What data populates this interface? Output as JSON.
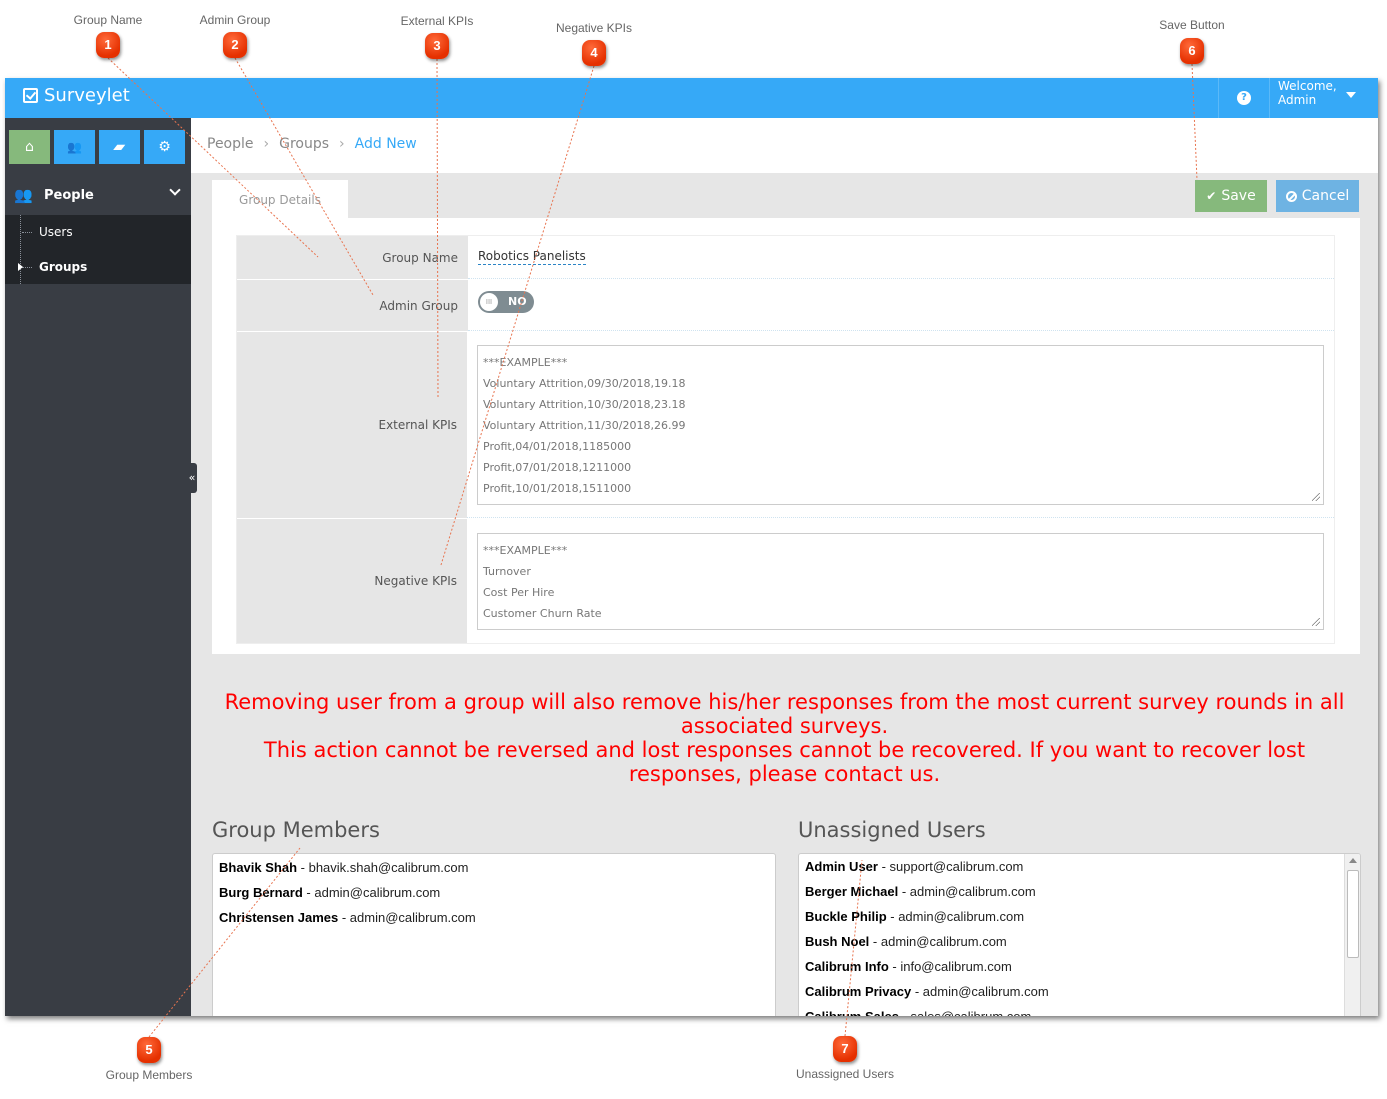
{
  "annotations": [
    {
      "number": "1",
      "label": "Group Name"
    },
    {
      "number": "2",
      "label": "Admin Group"
    },
    {
      "number": "3",
      "label": "External KPIs"
    },
    {
      "number": "4",
      "label": "Negative KPIs"
    },
    {
      "number": "5",
      "label": "Group Members"
    },
    {
      "number": "6",
      "label": "Save Button"
    },
    {
      "number": "7",
      "label": "Unassigned Users"
    }
  ],
  "header": {
    "app_name": "Surveylet",
    "help_icon": "?",
    "welcome_line1": "Welcome,",
    "welcome_line2": "Admin"
  },
  "sidebar": {
    "quick_buttons": [
      {
        "icon": "home-icon",
        "glyph": "⌂"
      },
      {
        "icon": "users-icon",
        "glyph": "👥"
      },
      {
        "icon": "book-icon",
        "glyph": "▰"
      },
      {
        "icon": "gears-icon",
        "glyph": "⚙"
      }
    ],
    "section": {
      "label": "People",
      "glyph": "👥"
    },
    "items": [
      {
        "label": "Users"
      },
      {
        "label": "Groups"
      }
    ],
    "collapse_glyph": "«"
  },
  "breadcrumb": {
    "items": [
      "People",
      "Groups"
    ],
    "separator": "›",
    "current": "Add New"
  },
  "tabs": {
    "group_details": "Group Details"
  },
  "actions": {
    "save": "Save",
    "save_glyph": "✔",
    "cancel": "Cancel"
  },
  "form": {
    "group_name_label": "Group Name",
    "group_name_value": "Robotics Panelists",
    "admin_group_label": "Admin Group",
    "admin_group_value": "NO",
    "toggle_knob": "III",
    "external_kpis_label": "External KPIs",
    "external_kpis_lines": [
      "***EXAMPLE***",
      "Voluntary Attrition,09/30/2018,19.18",
      "Voluntary Attrition,10/30/2018,23.18",
      "Voluntary Attrition,11/30/2018,26.99",
      "Profit,04/01/2018,1185000",
      "Profit,07/01/2018,1211000",
      "Profit,10/01/2018,1511000"
    ],
    "negative_kpis_label": "Negative KPIs",
    "negative_kpis_lines": [
      "***EXAMPLE***",
      "Turnover",
      "Cost Per Hire",
      "Customer Churn Rate"
    ]
  },
  "warning": {
    "line1": "Removing user from a group will also remove his/her responses from the most current survey rounds in all associated surveys.",
    "line2": "This action cannot be reversed and lost responses cannot be recovered. If you want to recover lost responses, please contact us."
  },
  "group_members": {
    "title": "Group Members",
    "items": [
      {
        "name": "Bhavik Shah",
        "email": "bhavik.shah@calibrum.com"
      },
      {
        "name": "Burg Bernard",
        "email": "admin@calibrum.com"
      },
      {
        "name": "Christensen James",
        "email": "admin@calibrum.com"
      }
    ]
  },
  "unassigned_users": {
    "title": "Unassigned Users",
    "items": [
      {
        "name": "Admin User",
        "email": "support@calibrum.com"
      },
      {
        "name": "Berger Michael",
        "email": "admin@calibrum.com"
      },
      {
        "name": "Buckle Philip",
        "email": "admin@calibrum.com"
      },
      {
        "name": "Bush Noel",
        "email": "admin@calibrum.com"
      },
      {
        "name": "Calibrum Info",
        "email": "info@calibrum.com"
      },
      {
        "name": "Calibrum Privacy",
        "email": "admin@calibrum.com"
      },
      {
        "name": "Calibrum Sales",
        "email": "sales@calibrum.com"
      }
    ]
  },
  "list_separator": " - "
}
